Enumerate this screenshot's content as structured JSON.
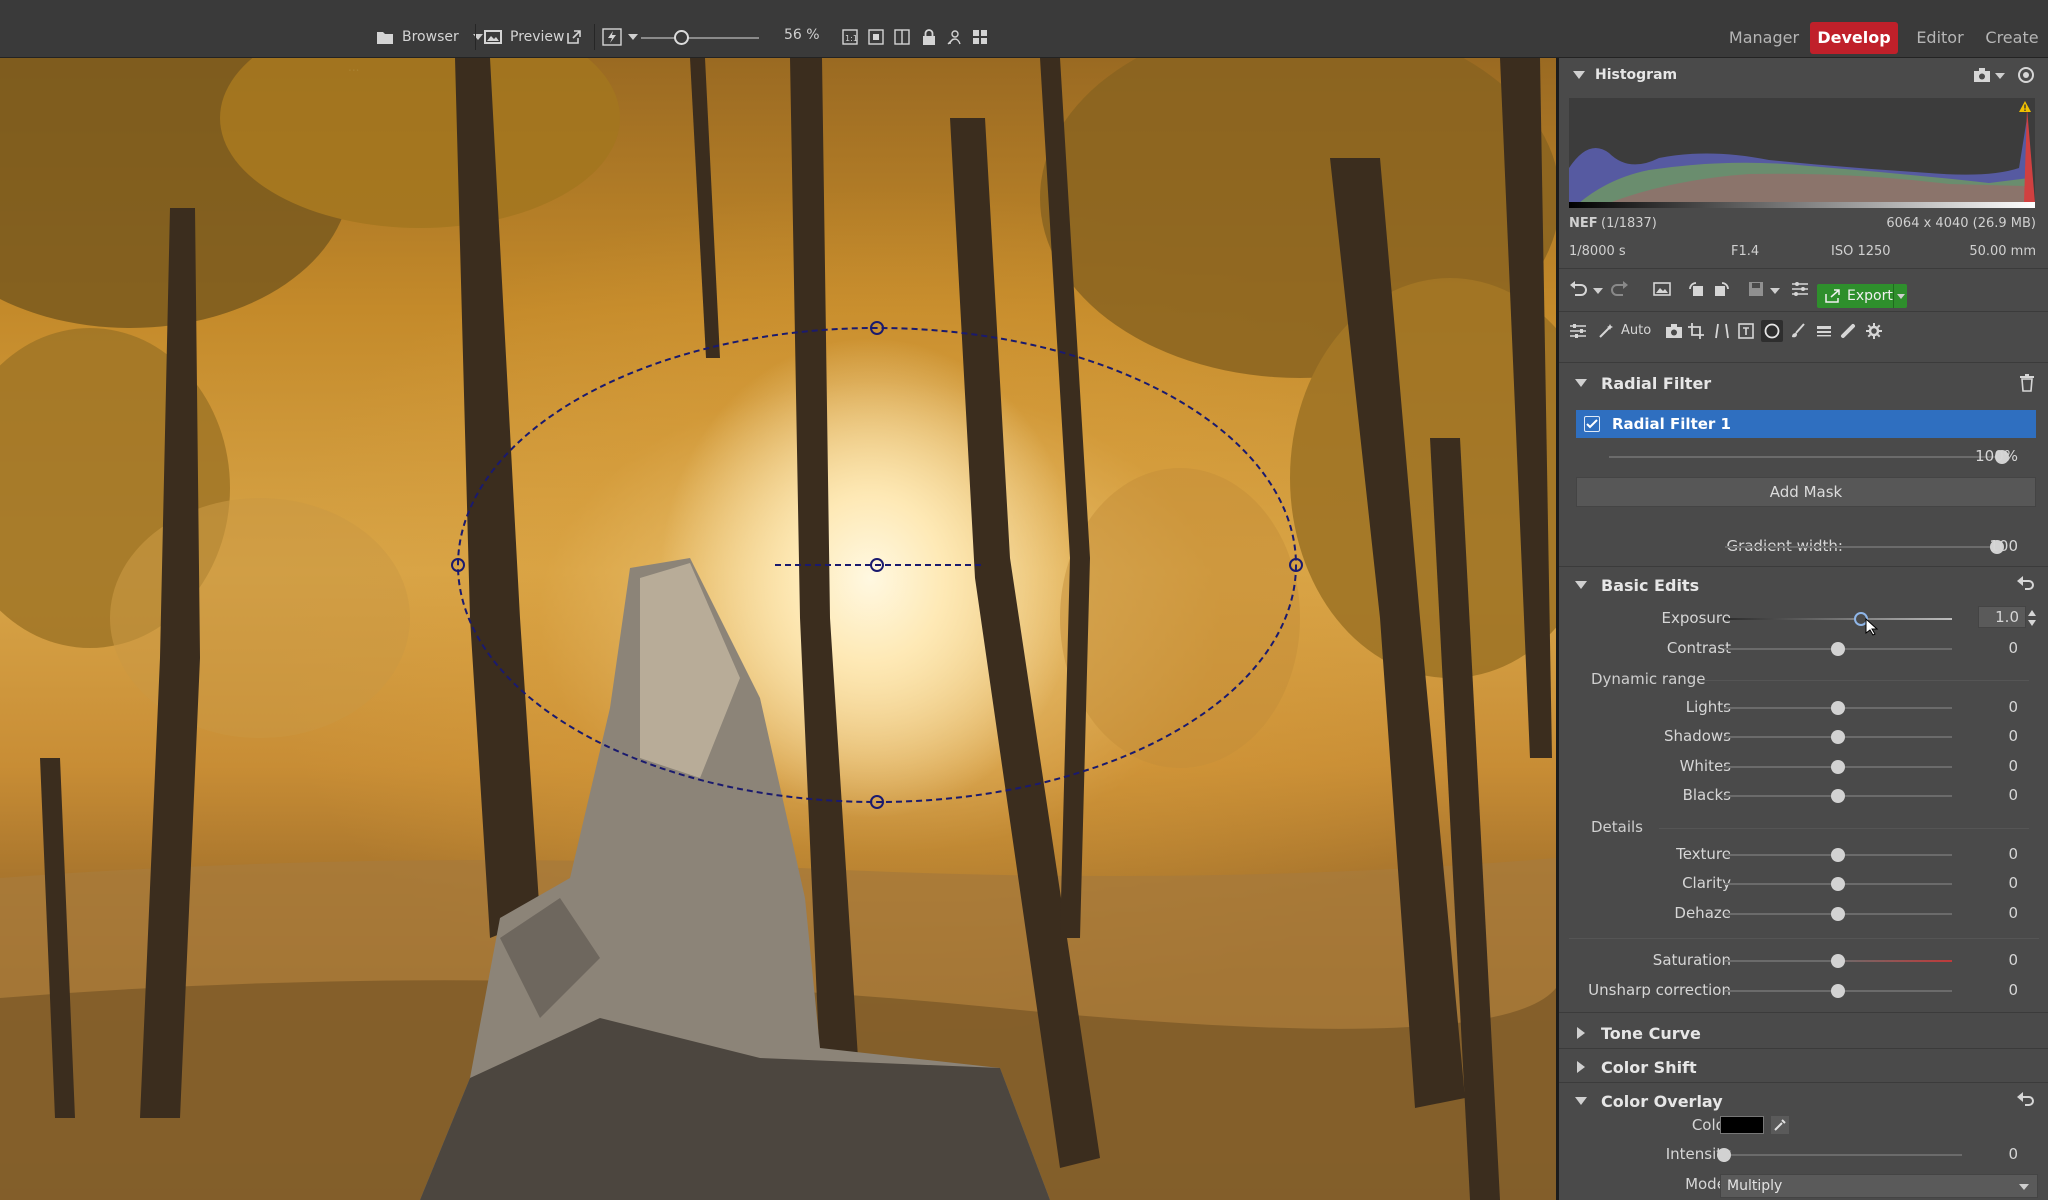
{
  "toolbar": {
    "browser_label": "Browser",
    "preview_label": "Preview",
    "zoom_label": "56 %",
    "zoom_fraction": 0.35
  },
  "modes": [
    {
      "label": "Manager"
    },
    {
      "label": "Develop",
      "active": true
    },
    {
      "label": "Editor"
    },
    {
      "label": "Create"
    }
  ],
  "canvas": {
    "caption": "...",
    "handle_color": "#1a1a6e"
  },
  "histogram": {
    "title": "Histogram",
    "format": "NEF",
    "index": "(1/1837)",
    "dimensions": "6064 x 4040 (26.9 MB)",
    "shutter": "1/8000 s",
    "aperture": "F1.4",
    "iso": "ISO 1250",
    "focal": "50.00 mm"
  },
  "actions": {
    "export_label": "Export",
    "auto_label": "Auto"
  },
  "radial_filter": {
    "title": "Radial Filter",
    "item_label": "Radial Filter 1",
    "item_checked": true,
    "opacity_value": "100%",
    "opacity_fraction": 1.0,
    "add_mask_label": "Add Mask",
    "gradient_width_label": "Gradient width:",
    "gradient_width_value": "100",
    "gradient_width_fraction": 1.0
  },
  "basic_edits": {
    "title": "Basic Edits",
    "exposure": {
      "label": "Exposure",
      "value": "1.0",
      "fraction": 0.6
    },
    "contrast": {
      "label": "Contrast",
      "value": "0",
      "fraction": 0.5
    },
    "dynamic_range_label": "Dynamic range",
    "lights": {
      "label": "Lights",
      "value": "0",
      "fraction": 0.5
    },
    "shadows": {
      "label": "Shadows",
      "value": "0",
      "fraction": 0.5
    },
    "whites": {
      "label": "Whites",
      "value": "0",
      "fraction": 0.5
    },
    "blacks": {
      "label": "Blacks",
      "value": "0",
      "fraction": 0.5
    },
    "details_label": "Details",
    "texture": {
      "label": "Texture",
      "value": "0",
      "fraction": 0.5
    },
    "clarity": {
      "label": "Clarity",
      "value": "0",
      "fraction": 0.5
    },
    "dehaze": {
      "label": "Dehaze",
      "value": "0",
      "fraction": 0.5
    },
    "saturation": {
      "label": "Saturation",
      "value": "0",
      "fraction": 0.5
    },
    "unsharp": {
      "label": "Unsharp correction",
      "value": "0",
      "fraction": 0.5
    }
  },
  "collapsed_sections": {
    "tone_curve": "Tone Curve",
    "color_shift": "Color Shift"
  },
  "color_overlay": {
    "title": "Color Overlay",
    "color_label": "Color",
    "color_value": "#000000",
    "intensity_label": "Intensity",
    "intensity_value": "0",
    "intensity_fraction": 0.0,
    "mode_label": "Mode:",
    "mode_value": "Multiply"
  },
  "colors": {
    "accent_red": "#c0202a",
    "selection_blue": "#2f6fc0",
    "export_green": "#2e8f2c"
  }
}
